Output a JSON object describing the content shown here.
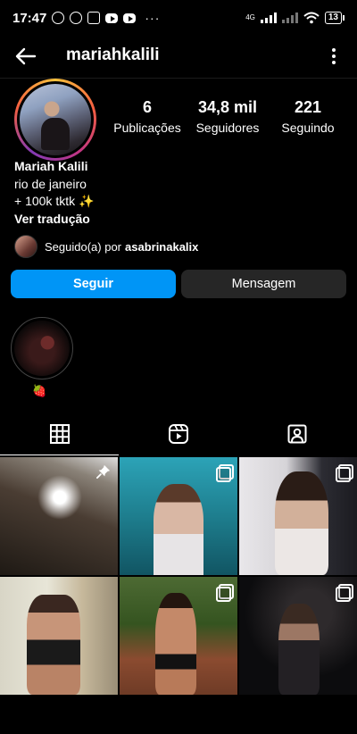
{
  "status_bar": {
    "time": "17:47",
    "network": "4G",
    "battery": "13",
    "overflow": "···"
  },
  "header": {
    "username": "mariahkalili"
  },
  "profile": {
    "stats": [
      {
        "value": "6",
        "label": "Publicações"
      },
      {
        "value": "34,8 mil",
        "label": "Seguidores"
      },
      {
        "value": "221",
        "label": "Seguindo"
      }
    ],
    "name": "Mariah Kalili",
    "bio_lines": [
      "rio de janeiro",
      "+ 100k tktk ✨"
    ],
    "translate_link": "Ver tradução",
    "followed_by_prefix": "Seguido(a) por",
    "followed_by_user": "asabrinakalix"
  },
  "actions": {
    "follow_label": "Seguir",
    "message_label": "Mensagem"
  },
  "highlight": {
    "label": "🍓"
  },
  "tabs": [
    {
      "icon": "grid-icon",
      "active": true
    },
    {
      "icon": "reels-icon",
      "active": false
    },
    {
      "icon": "tagged-icon",
      "active": false
    }
  ],
  "posts": [
    {
      "badge": "pin-icon"
    },
    {
      "badge": "multi-photo-icon"
    },
    {
      "badge": "multi-photo-icon"
    },
    {
      "badge": ""
    },
    {
      "badge": "multi-photo-icon"
    },
    {
      "badge": "multi-photo-icon"
    }
  ],
  "colors": {
    "follow_button": "#0095f6",
    "message_button": "#262626",
    "background": "#000000"
  }
}
